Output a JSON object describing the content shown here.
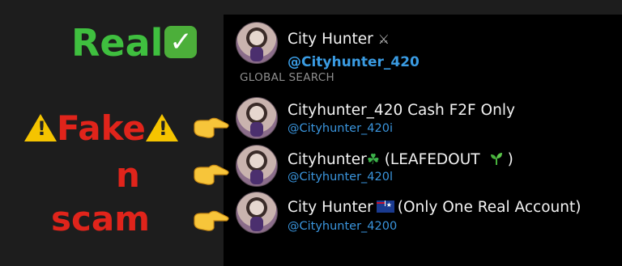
{
  "labels": {
    "real": "Real",
    "real_check": "✓",
    "fake": "Fake",
    "warn_symbol": "!",
    "n": "n",
    "scam": "scam"
  },
  "search": {
    "real_account": {
      "name": "City Hunter",
      "name_emoji": "🥷",
      "handle": "@Cityhunter_420"
    },
    "section_header": "GLOBAL SEARCH",
    "results": [
      {
        "name": "Cityhunter_420 Cash F2F Only",
        "handle": "@Cityhunter_420i"
      },
      {
        "name_prefix": "Cityhunter",
        "name_emoji_1": "☘",
        "name_middle": " (LEAFEDOUT ",
        "name_emoji_2": "🌱",
        "name_suffix": ")",
        "handle": "@Cityhunter_420l"
      },
      {
        "name_prefix": "City Hunter",
        "name_suffix": "(Only One Real Account)",
        "handle": "@Cityhunter_4200"
      }
    ]
  },
  "colors": {
    "real_text": "#3fbf3f",
    "fake_text": "#e0241b",
    "handle_blue": "#3a95dd",
    "panel_bg": "#000000",
    "page_bg": "#1d1d1d"
  }
}
